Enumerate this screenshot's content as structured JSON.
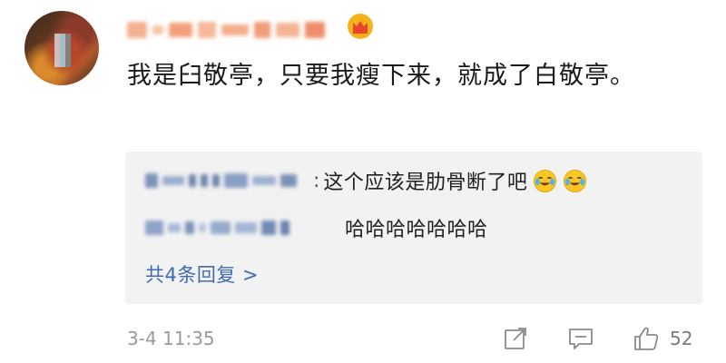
{
  "comment": {
    "username_hidden": true,
    "badge_icon": "crown-icon",
    "text": "我是臼敬亭，只要我瘦下来，就成了白敬亭。"
  },
  "replies": [
    {
      "user_hidden": true,
      "text": "这个应该是肋骨断了吧",
      "emojis": [
        "laugh-cry-emoji",
        "laugh-cry-emoji"
      ]
    },
    {
      "user_hidden": true,
      "text": "哈哈哈哈哈哈哈"
    }
  ],
  "more_replies_label": "共4条回复 >",
  "footer": {
    "time": "3-4 11:35",
    "share_icon": "share-icon",
    "comment_icon": "comment-icon",
    "like_icon": "thumbs-up-icon",
    "like_count": "52"
  },
  "colors": {
    "link": "#3f6bb0",
    "reply_bg": "#f2f2f2",
    "meta": "#9a9a9a"
  }
}
